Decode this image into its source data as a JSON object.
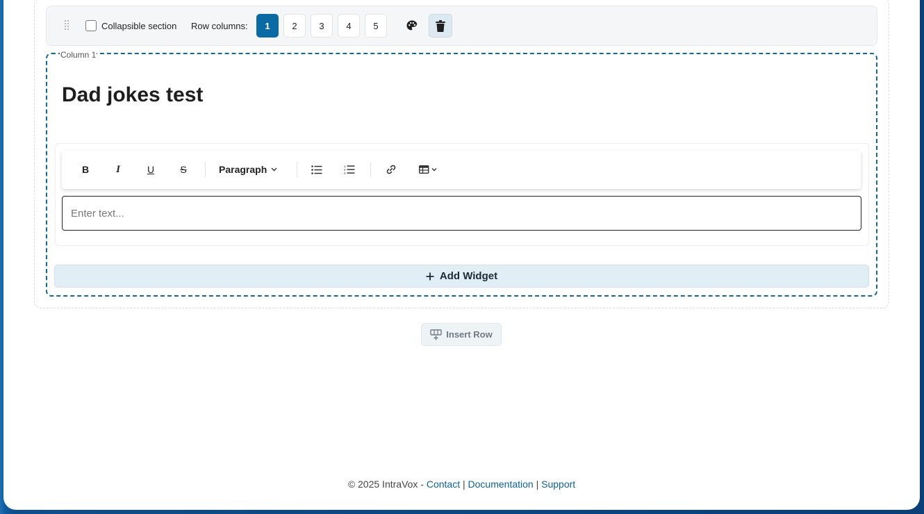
{
  "row_toolbar": {
    "collapsible_label": "Collapsible section",
    "collapsible_checked": false,
    "row_columns_label": "Row columns:",
    "column_options": [
      "1",
      "2",
      "3",
      "4",
      "5"
    ],
    "selected_columns": "1",
    "palette_icon": "palette-icon",
    "delete_icon": "trash-icon"
  },
  "column": {
    "label": "Column 1",
    "heading": "Dad jokes test"
  },
  "editor": {
    "toolbar": {
      "bold": "B",
      "italic": "I",
      "underline": "U",
      "strikethrough": "S",
      "paragraph_select": "Paragraph",
      "bullet_list_icon": "bullet-list-icon",
      "numbered_list_icon": "numbered-list-icon",
      "link_icon": "link-icon",
      "table_icon": "table-icon"
    },
    "placeholder": "Enter text..."
  },
  "add_widget": {
    "label": "Add Widget"
  },
  "insert_row": {
    "label": "Insert Row"
  },
  "footer": {
    "copyright": "© 2025 IntraVox -",
    "links": [
      "Contact",
      "Documentation",
      "Support"
    ],
    "separator": "|"
  },
  "colors": {
    "accent": "#0a6aa3",
    "column_border": "#0f6a97",
    "link": "#0a62a0",
    "add_widget_bg": "#e2eef5"
  }
}
